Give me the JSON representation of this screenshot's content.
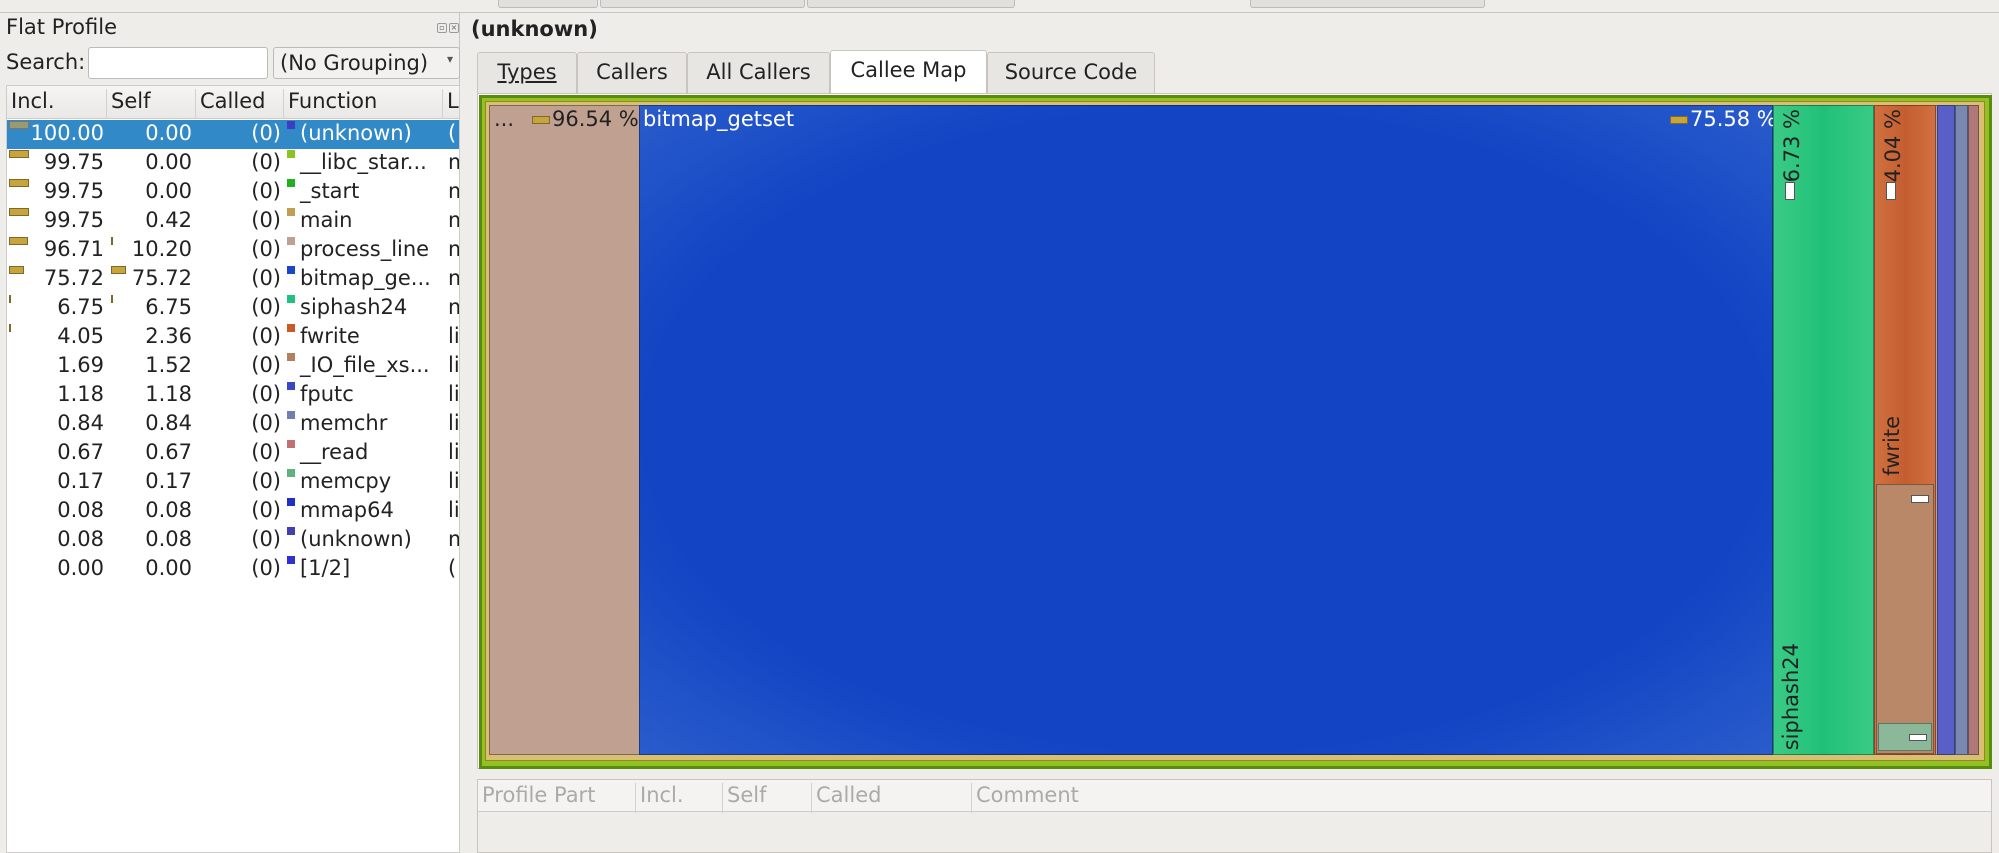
{
  "flat_profile": {
    "title": "Flat Profile",
    "search_label": "Search:",
    "search_value": "",
    "grouping": "(No Grouping)",
    "columns": [
      "Incl.",
      "Self",
      "Called",
      "Function",
      "L"
    ],
    "rows": [
      {
        "incl": "100.00",
        "self": "0.00",
        "called": "(0)",
        "function": "(unknown)",
        "loc": "(",
        "color": "#3d3dc4",
        "incl_frac": 1.0,
        "self_frac": 0,
        "selected": true
      },
      {
        "incl": "99.75",
        "self": "0.00",
        "called": "(0)",
        "function": "__libc_star...",
        "loc": "m",
        "color": "#8ac41c",
        "incl_frac": 0.9975,
        "self_frac": 0
      },
      {
        "incl": "99.75",
        "self": "0.00",
        "called": "(0)",
        "function": "_start",
        "loc": "m",
        "color": "#20b020",
        "incl_frac": 0.9975,
        "self_frac": 0
      },
      {
        "incl": "99.75",
        "self": "0.42",
        "called": "(0)",
        "function": "main",
        "loc": "m",
        "color": "#c0a050",
        "incl_frac": 0.9975,
        "self_frac": 0.0042
      },
      {
        "incl": "96.71",
        "self": "10.20",
        "called": "(0)",
        "function": "process_line",
        "loc": "m",
        "color": "#c0a090",
        "incl_frac": 0.9671,
        "self_frac": 0.102
      },
      {
        "incl": "75.72",
        "self": "75.72",
        "called": "(0)",
        "function": "bitmap_ge...",
        "loc": "m",
        "color": "#1848c8",
        "incl_frac": 0.7572,
        "self_frac": 0.7572
      },
      {
        "incl": "6.75",
        "self": "6.75",
        "called": "(0)",
        "function": "siphash24",
        "loc": "m",
        "color": "#20c080",
        "incl_frac": 0.0675,
        "self_frac": 0.0675
      },
      {
        "incl": "4.05",
        "self": "2.36",
        "called": "(0)",
        "function": "fwrite",
        "loc": "li",
        "color": "#c85a28",
        "incl_frac": 0.0405,
        "self_frac": 0.0236
      },
      {
        "incl": "1.69",
        "self": "1.52",
        "called": "(0)",
        "function": "_IO_file_xs...",
        "loc": "li",
        "color": "#b08060",
        "incl_frac": 0.0169,
        "self_frac": 0.0152
      },
      {
        "incl": "1.18",
        "self": "1.18",
        "called": "(0)",
        "function": "fputc",
        "loc": "li",
        "color": "#3848c0",
        "incl_frac": 0.0118,
        "self_frac": 0.0118
      },
      {
        "incl": "0.84",
        "self": "0.84",
        "called": "(0)",
        "function": "memchr",
        "loc": "li",
        "color": "#7080b0",
        "incl_frac": 0.0084,
        "self_frac": 0.0084
      },
      {
        "incl": "0.67",
        "self": "0.67",
        "called": "(0)",
        "function": "__read",
        "loc": "li",
        "color": "#c07070",
        "incl_frac": 0.0067,
        "self_frac": 0.0067
      },
      {
        "incl": "0.17",
        "self": "0.17",
        "called": "(0)",
        "function": "memcpy",
        "loc": "li",
        "color": "#60b080",
        "incl_frac": 0.0017,
        "self_frac": 0.0017
      },
      {
        "incl": "0.08",
        "self": "0.08",
        "called": "(0)",
        "function": "mmap64",
        "loc": "li",
        "color": "#2030c0",
        "incl_frac": 0.0008,
        "self_frac": 0.0008
      },
      {
        "incl": "0.08",
        "self": "0.08",
        "called": "(0)",
        "function": "(unknown)",
        "loc": "m",
        "color": "#4040b0",
        "incl_frac": 0.0008,
        "self_frac": 0.0008
      },
      {
        "incl": "0.00",
        "self": "0.00",
        "called": "(0)",
        "function": "[1/2]",
        "loc": "(",
        "color": "#3030d0",
        "incl_frac": 0,
        "self_frac": 0
      }
    ]
  },
  "detail": {
    "title": "(unknown)",
    "tabs": [
      {
        "label": "Types"
      },
      {
        "label": "Callers"
      },
      {
        "label": "All Callers"
      },
      {
        "label": "Callee Map",
        "active": true
      },
      {
        "label": "Source Code"
      }
    ],
    "callee_map": {
      "process_line": {
        "label": "...",
        "pct": "96.54 %"
      },
      "bitmap_getset": {
        "label": "bitmap_getset",
        "pct": "75.58 %"
      },
      "siphash24": {
        "label": "siphash24",
        "pct": "6.73 %"
      },
      "fwrite": {
        "label": "fwrite",
        "pct": "4.04 %"
      }
    },
    "bottom_columns": [
      "Profile Part",
      "Incl.",
      "Self",
      "Called",
      "Comment"
    ]
  }
}
